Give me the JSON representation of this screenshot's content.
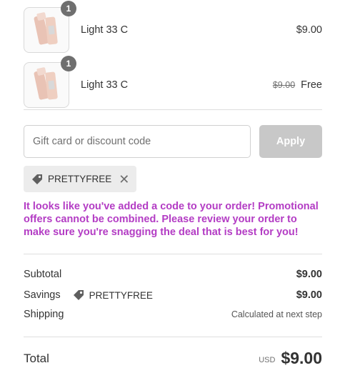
{
  "items": [
    {
      "quantity": "1",
      "name": "Light 33 C",
      "price": "$9.00",
      "original_price": "",
      "final_price": ""
    },
    {
      "quantity": "1",
      "name": "Light 33 C",
      "price": "",
      "original_price": "$9.00",
      "final_price": "Free"
    }
  ],
  "discount": {
    "placeholder": "Gift card or discount code",
    "apply_label": "Apply",
    "applied_code": "PRETTYFREE",
    "tag_icon": "tag-icon",
    "remove_icon": "close-icon"
  },
  "promo_message": "It looks like you've added a code to your order! Promotional offers cannot be combined. Please review your order to make sure you're snagging the deal that is best for you!",
  "summary": {
    "subtotal_label": "Subtotal",
    "subtotal_value": "$9.00",
    "savings_label": "Savings",
    "savings_code": "PRETTYFREE",
    "savings_value": "$9.00",
    "shipping_label": "Shipping",
    "shipping_value": "Calculated at next step",
    "total_label": "Total",
    "currency": "USD",
    "total_value": "$9.00"
  },
  "colors": {
    "promo_text": "#b33cc4",
    "apply_button_disabled": "#c8c8c8",
    "chip_background": "#ececec",
    "quantity_badge": "#6f6f6f"
  }
}
